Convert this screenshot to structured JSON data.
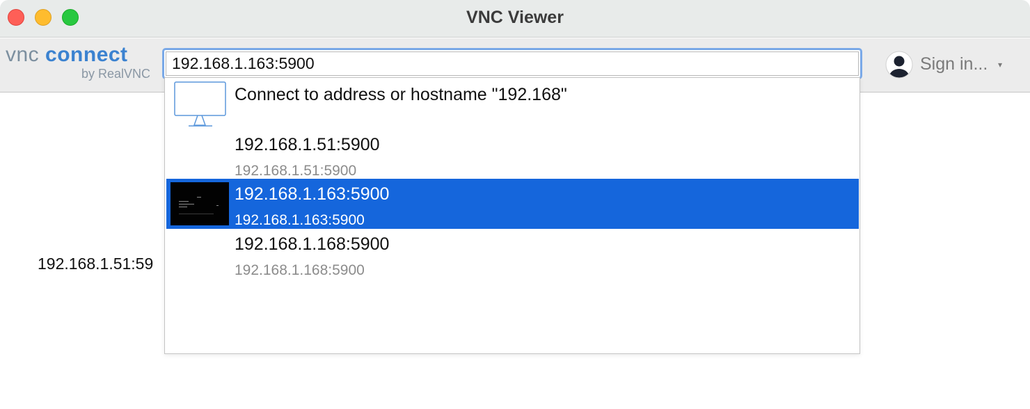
{
  "window": {
    "title": "VNC Viewer"
  },
  "logo": {
    "vnc": "vnc",
    "connect": "connect",
    "sub": "by RealVNC"
  },
  "address_bar": {
    "value": "192.168.1.163:5900"
  },
  "account": {
    "sign_in_label": "Sign in...",
    "caret": "▾"
  },
  "background": {
    "label": "192.168.1.51:59"
  },
  "dropdown": {
    "connect_item": {
      "label": "Connect to address or hostname \"192.168\""
    },
    "items": [
      {
        "name": "192.168.1.51:5900",
        "address": "192.168.1.51:5900",
        "selected": false
      },
      {
        "name": "192.168.1.163:5900",
        "address": "192.168.1.163:5900",
        "selected": true
      },
      {
        "name": "192.168.1.168:5900",
        "address": "192.168.1.168:5900",
        "selected": false
      }
    ]
  },
  "colors": {
    "selection": "#1566dc",
    "focus_ring": "#7aa9e8",
    "brand_blue": "#3b82d0",
    "close": "#fe5f57",
    "minimize": "#febc2e",
    "zoom": "#28c840"
  },
  "icons": {
    "connect_item": "monitor-icon",
    "account": "user-avatar-icon"
  }
}
